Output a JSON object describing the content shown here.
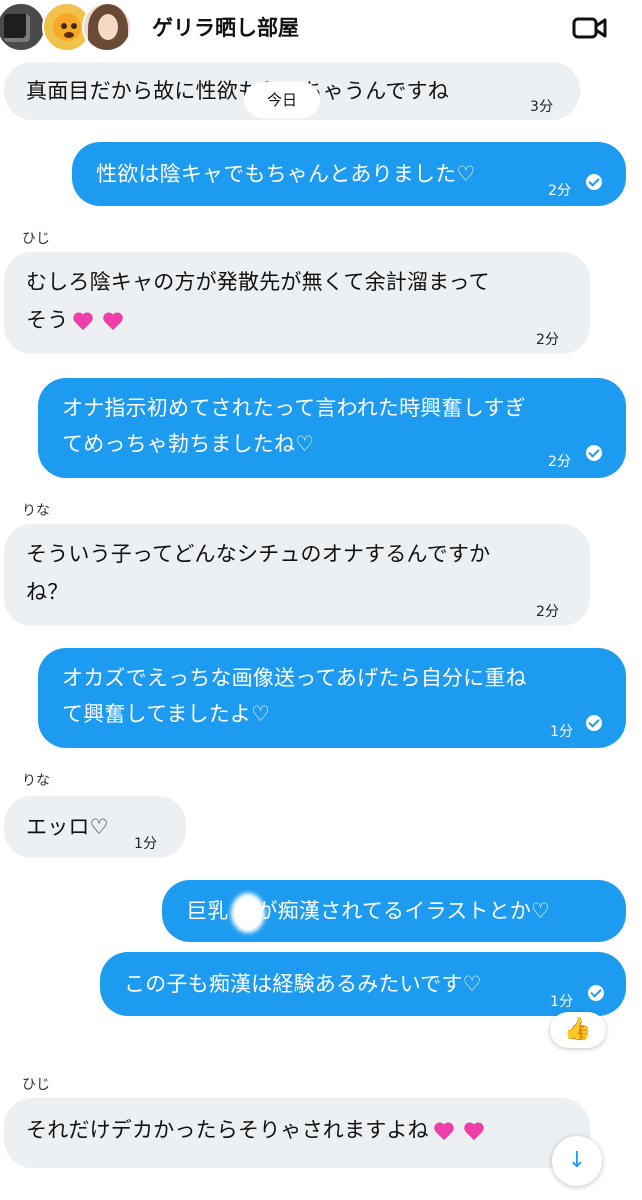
{
  "header": {
    "title": "ゲリラ晒し部屋",
    "video_icon": "video-camera-icon"
  },
  "today_label": "今日",
  "messages": [
    {
      "dir": "in",
      "lines": [
        "真面目だから故に性欲もえっちゃうんですね"
      ],
      "time": "3分"
    },
    {
      "dir": "out",
      "lines": [
        "性欲は陰キャでもちゃんとありました♡"
      ],
      "time": "2分"
    },
    {
      "dir": "in",
      "sender": "ひじ",
      "lines": [
        "むしろ陰キャの方が発散先が無くて余計溜まって",
        "そう"
      ],
      "time": "2分"
    },
    {
      "dir": "out",
      "lines": [
        "オナ指示初めてされたって言われた時興奮しすぎ",
        "てめっちゃ勃ちましたね♡"
      ],
      "time": "2分"
    },
    {
      "dir": "in",
      "sender": "りな",
      "lines": [
        "そういう子ってどんなシチュのオナするんですか",
        "ね？"
      ],
      "time": "2分"
    },
    {
      "dir": "out",
      "lines": [
        "オカズでえっちな画像送ってあげたら自分に重ね",
        "て興奮してましたよ♡"
      ],
      "time": "1分"
    },
    {
      "dir": "in",
      "sender": "りな",
      "lines": [
        "エッロ♡"
      ],
      "time": "1分"
    },
    {
      "dir": "out",
      "lines": [
        "巨乳 　が痴漢されてるイラストとか♡"
      ],
      "time": ""
    },
    {
      "dir": "out",
      "lines": [
        "この子も痴漢は経験あるみたいです♡"
      ],
      "time": "1分",
      "reaction": "thumbs-up-icon"
    },
    {
      "dir": "in",
      "sender": "ひじ",
      "lines": [
        "それだけデカかったらそりゃされますよね"
      ],
      "time": ""
    }
  ],
  "colors": {
    "outgoing": "#1d9bf0",
    "incoming": "#edf0f3",
    "heart": "#ec3fa8"
  },
  "scroll_button": {
    "icon": "arrow-down-icon",
    "glyph": "↓"
  },
  "reaction_glyph": "👍"
}
